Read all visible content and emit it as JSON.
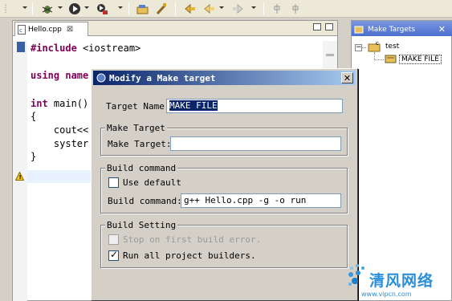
{
  "toolbar": {
    "items": [
      "debug-icon",
      "run-icon",
      "external-tools-icon",
      "open-folder-icon",
      "make-icon",
      "last-edit-icon",
      "back-icon",
      "forward-icon",
      "pin-icon"
    ]
  },
  "editor": {
    "tab_label": "Hello.cpp",
    "lines": [
      {
        "kw": "#include",
        "text": " <iostream>"
      },
      {
        "kw": "using",
        "text": " name"
      },
      {
        "kw": "int",
        "text": " main()"
      },
      {
        "kw": "",
        "text": "{"
      },
      {
        "kw": "",
        "text": "    cout<<"
      },
      {
        "kw": "",
        "text": "    syster"
      },
      {
        "kw": "",
        "text": "}"
      }
    ]
  },
  "make_targets": {
    "tab_label": "Make Targets",
    "project": "test",
    "target": "MAKE FILE"
  },
  "dialog": {
    "title": "Modify a Make target",
    "target_name_label": "Target Name:",
    "target_name_value": "MAKE FILE",
    "make_target_group": "Make Target",
    "make_target_label": "Make Target:",
    "make_target_value": "",
    "build_command_group": "Build command",
    "use_default_label": "Use default",
    "use_default_checked": false,
    "build_command_label": "Build command:",
    "build_command_value": "g++ Hello.cpp -g -o run",
    "build_setting_group": "Build Setting",
    "stop_on_error_label": "Stop on first build error.",
    "stop_on_error_checked": false,
    "run_all_label": "Run all project builders.",
    "run_all_checked": true
  },
  "watermark": {
    "name": "清风网络",
    "url": "www.vipcn.com"
  }
}
